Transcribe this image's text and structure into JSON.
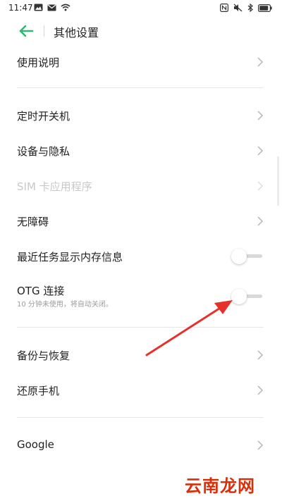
{
  "status_bar": {
    "time": "11:47",
    "left_icons": [
      "image-icon",
      "mail-icon",
      "wifi-icon"
    ],
    "right_icons": [
      "nfc-icon",
      "mute-icon",
      "bluetooth-icon",
      "battery-icon"
    ]
  },
  "header": {
    "title": "其他设置"
  },
  "items": [
    {
      "label": "使用说明"
    },
    {
      "label": "定时开关机"
    },
    {
      "label": "设备与隐私"
    },
    {
      "label": "SIM 卡应用程序",
      "disabled": true
    },
    {
      "label": "无障碍"
    },
    {
      "label": "最近任务显示内存信息",
      "toggle": false
    },
    {
      "label": "OTG 连接",
      "subtitle": "10 分钟未使用，将自动关闭。",
      "toggle": false
    },
    {
      "label": "备份与恢复"
    },
    {
      "label": "还原手机"
    },
    {
      "label": "Google"
    }
  ],
  "annotation": {
    "type": "red-arrow",
    "color": "#e8302a"
  },
  "watermark": "云南龙网"
}
